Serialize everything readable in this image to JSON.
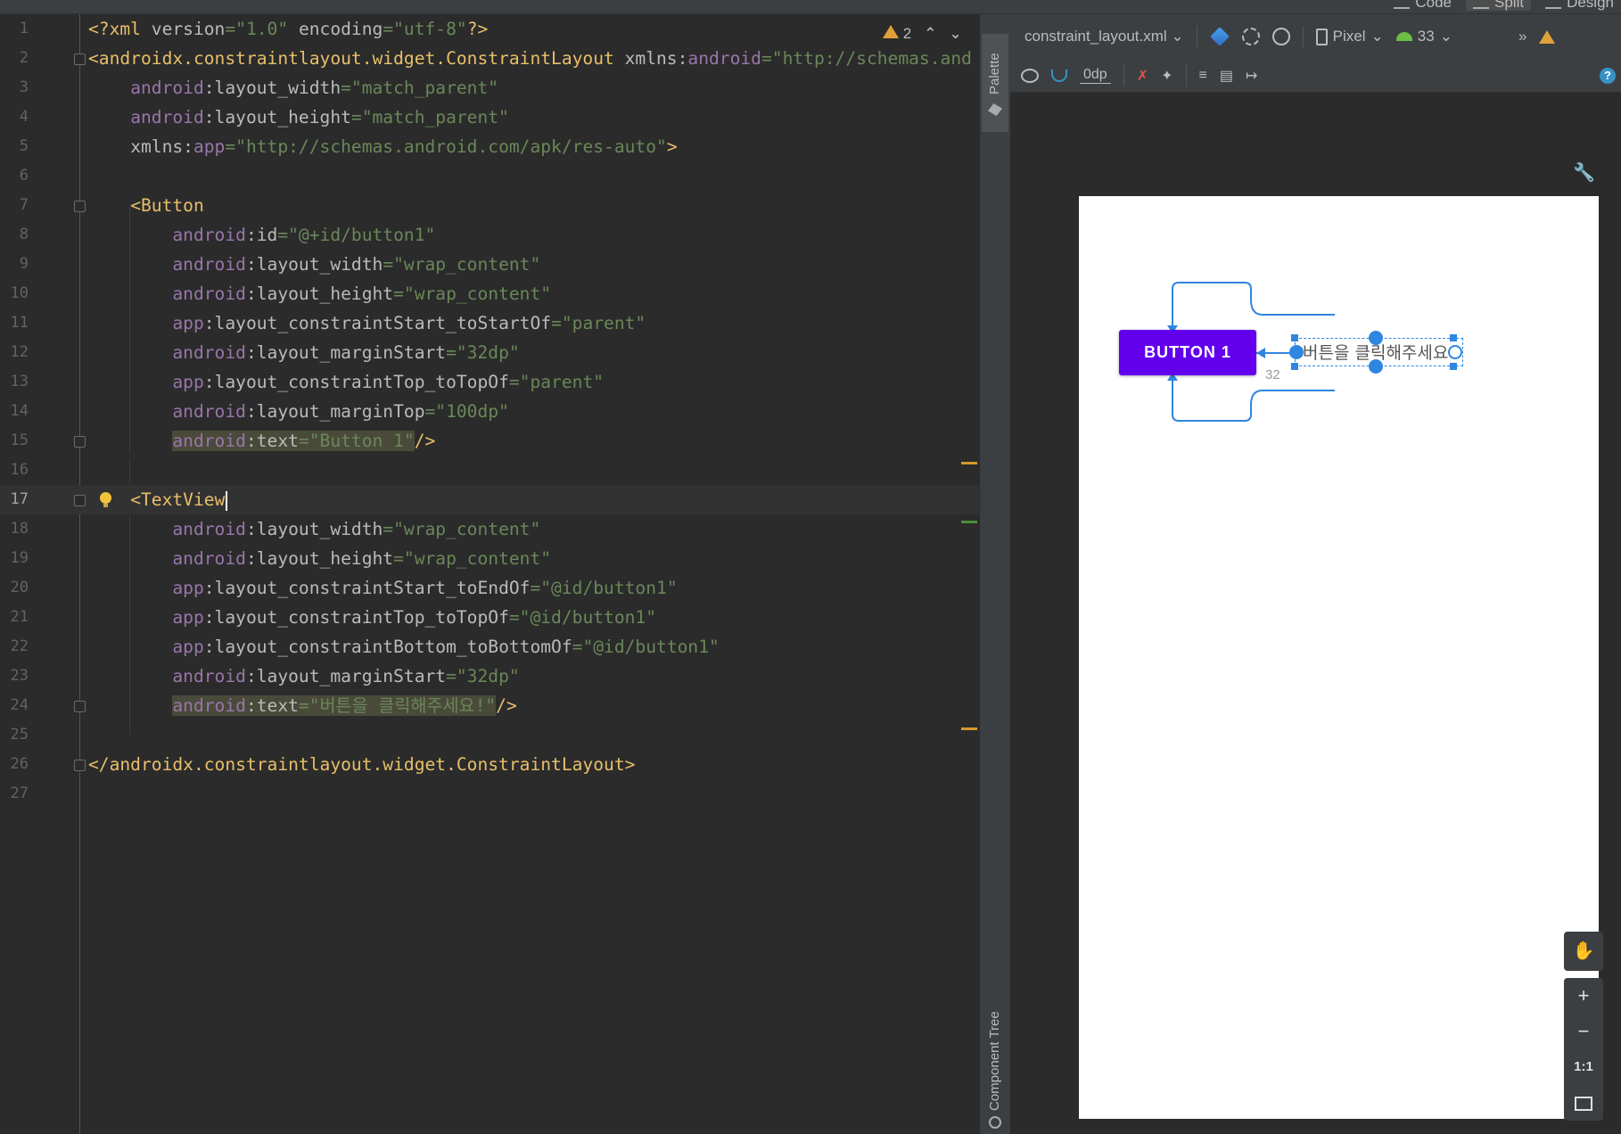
{
  "window": {
    "view_modes": [
      "Code",
      "Split",
      "Design"
    ],
    "active_view_mode": "Split"
  },
  "editor": {
    "current_line": 17,
    "inspection": {
      "warnings": "2"
    },
    "lines": [
      {
        "n": "1",
        "tokens": [
          {
            "c": "tag",
            "t": "<?xml "
          },
          {
            "c": "attr",
            "t": "version"
          },
          {
            "c": "val",
            "t": "=\"1.0\" "
          },
          {
            "c": "attr",
            "t": "encoding"
          },
          {
            "c": "val",
            "t": "=\"utf-8\""
          },
          {
            "c": "tag",
            "t": "?>"
          }
        ]
      },
      {
        "n": "2",
        "tokens": [
          {
            "c": "tag",
            "t": "<androidx.constraintlayout.widget.ConstraintLayout "
          },
          {
            "c": "attr",
            "t": "xmlns:"
          },
          {
            "c": "ns",
            "t": "android"
          },
          {
            "c": "val",
            "t": "=\"http://schemas.and"
          }
        ]
      },
      {
        "n": "3",
        "tokens": [
          {
            "c": "plain",
            "t": "    "
          },
          {
            "c": "ns",
            "t": "android"
          },
          {
            "c": "attr",
            "t": ":layout_width"
          },
          {
            "c": "val",
            "t": "=\"match_parent\""
          }
        ]
      },
      {
        "n": "4",
        "tokens": [
          {
            "c": "plain",
            "t": "    "
          },
          {
            "c": "ns",
            "t": "android"
          },
          {
            "c": "attr",
            "t": ":layout_height"
          },
          {
            "c": "val",
            "t": "=\"match_parent\""
          }
        ]
      },
      {
        "n": "5",
        "tokens": [
          {
            "c": "plain",
            "t": "    "
          },
          {
            "c": "attr",
            "t": "xmlns:"
          },
          {
            "c": "ns",
            "t": "app"
          },
          {
            "c": "val",
            "t": "=\"http://schemas.android.com/apk/res-auto\""
          },
          {
            "c": "tag",
            "t": ">"
          }
        ]
      },
      {
        "n": "6",
        "tokens": []
      },
      {
        "n": "7",
        "tokens": [
          {
            "c": "plain",
            "t": "    "
          },
          {
            "c": "tag",
            "t": "<Button"
          }
        ]
      },
      {
        "n": "8",
        "tokens": [
          {
            "c": "plain",
            "t": "        "
          },
          {
            "c": "ns",
            "t": "android"
          },
          {
            "c": "attr",
            "t": ":id"
          },
          {
            "c": "val",
            "t": "=\"@+id/button1\""
          }
        ]
      },
      {
        "n": "9",
        "tokens": [
          {
            "c": "plain",
            "t": "        "
          },
          {
            "c": "ns",
            "t": "android"
          },
          {
            "c": "attr",
            "t": ":layout_width"
          },
          {
            "c": "val",
            "t": "=\"wrap_content\""
          }
        ]
      },
      {
        "n": "10",
        "tokens": [
          {
            "c": "plain",
            "t": "        "
          },
          {
            "c": "ns",
            "t": "android"
          },
          {
            "c": "attr",
            "t": ":layout_height"
          },
          {
            "c": "val",
            "t": "=\"wrap_content\""
          }
        ]
      },
      {
        "n": "11",
        "tokens": [
          {
            "c": "plain",
            "t": "        "
          },
          {
            "c": "ns",
            "t": "app"
          },
          {
            "c": "attr",
            "t": ":layout_constraintStart_toStartOf"
          },
          {
            "c": "val",
            "t": "=\"parent\""
          }
        ]
      },
      {
        "n": "12",
        "tokens": [
          {
            "c": "plain",
            "t": "        "
          },
          {
            "c": "ns",
            "t": "android"
          },
          {
            "c": "attr",
            "t": ":layout_marginStart"
          },
          {
            "c": "val",
            "t": "=\"32dp\""
          }
        ]
      },
      {
        "n": "13",
        "tokens": [
          {
            "c": "plain",
            "t": "        "
          },
          {
            "c": "ns",
            "t": "app"
          },
          {
            "c": "attr",
            "t": ":layout_constraintTop_toTopOf"
          },
          {
            "c": "val",
            "t": "=\"parent\""
          }
        ]
      },
      {
        "n": "14",
        "tokens": [
          {
            "c": "plain",
            "t": "        "
          },
          {
            "c": "ns",
            "t": "android"
          },
          {
            "c": "attr",
            "t": ":layout_marginTop"
          },
          {
            "c": "val",
            "t": "=\"100dp\""
          }
        ]
      },
      {
        "n": "15",
        "tokens": [
          {
            "c": "plain",
            "t": "        "
          },
          {
            "c": "ns",
            "t": "android",
            "h": 1
          },
          {
            "c": "attr",
            "t": ":text",
            "h": 1
          },
          {
            "c": "val",
            "t": "=\"Button 1\"",
            "h": 1
          },
          {
            "c": "tag",
            "t": "/>"
          }
        ]
      },
      {
        "n": "16",
        "tokens": []
      },
      {
        "n": "17",
        "tokens": [
          {
            "c": "plain",
            "t": "    "
          },
          {
            "c": "tag",
            "t": "<TextView"
          }
        ]
      },
      {
        "n": "18",
        "tokens": [
          {
            "c": "plain",
            "t": "        "
          },
          {
            "c": "ns",
            "t": "android"
          },
          {
            "c": "attr",
            "t": ":layout_width"
          },
          {
            "c": "val",
            "t": "=\"wrap_content\""
          }
        ]
      },
      {
        "n": "19",
        "tokens": [
          {
            "c": "plain",
            "t": "        "
          },
          {
            "c": "ns",
            "t": "android"
          },
          {
            "c": "attr",
            "t": ":layout_height"
          },
          {
            "c": "val",
            "t": "=\"wrap_content\""
          }
        ]
      },
      {
        "n": "20",
        "tokens": [
          {
            "c": "plain",
            "t": "        "
          },
          {
            "c": "ns",
            "t": "app"
          },
          {
            "c": "attr",
            "t": ":layout_constraintStart_toEndOf"
          },
          {
            "c": "val",
            "t": "=\"@id/button1\""
          }
        ]
      },
      {
        "n": "21",
        "tokens": [
          {
            "c": "plain",
            "t": "        "
          },
          {
            "c": "ns",
            "t": "app"
          },
          {
            "c": "attr",
            "t": ":layout_constraintTop_toTopOf"
          },
          {
            "c": "val",
            "t": "=\"@id/button1\""
          }
        ]
      },
      {
        "n": "22",
        "tokens": [
          {
            "c": "plain",
            "t": "        "
          },
          {
            "c": "ns",
            "t": "app"
          },
          {
            "c": "attr",
            "t": ":layout_constraintBottom_toBottomOf"
          },
          {
            "c": "val",
            "t": "=\"@id/button1\""
          }
        ]
      },
      {
        "n": "23",
        "tokens": [
          {
            "c": "plain",
            "t": "        "
          },
          {
            "c": "ns",
            "t": "android"
          },
          {
            "c": "attr",
            "t": ":layout_marginStart"
          },
          {
            "c": "val",
            "t": "=\"32dp\""
          }
        ]
      },
      {
        "n": "24",
        "tokens": [
          {
            "c": "plain",
            "t": "        "
          },
          {
            "c": "ns",
            "t": "android",
            "h": 1
          },
          {
            "c": "attr",
            "t": ":text",
            "h": 1
          },
          {
            "c": "val",
            "t": "=\"버튼을 클릭해주세요!\"",
            "h": 1
          },
          {
            "c": "tag",
            "t": "/>"
          }
        ]
      },
      {
        "n": "25",
        "tokens": []
      },
      {
        "n": "26",
        "tokens": [
          {
            "c": "tag",
            "t": "</androidx.constraintlayout.widget.ConstraintLayout>"
          }
        ]
      },
      {
        "n": "27",
        "tokens": []
      }
    ]
  },
  "side_panels": {
    "palette": "Palette",
    "component_tree": "Component Tree"
  },
  "design": {
    "file_name": "constraint_layout.xml",
    "device": "Pixel",
    "api_level": "33",
    "default_margin": "0dp",
    "preview": {
      "button_text": "BUTTON 1",
      "textview_text": "버튼을 클릭해주세요!",
      "margin_label": "32"
    },
    "zoom_controls": [
      "+",
      "−",
      "1:1"
    ]
  }
}
